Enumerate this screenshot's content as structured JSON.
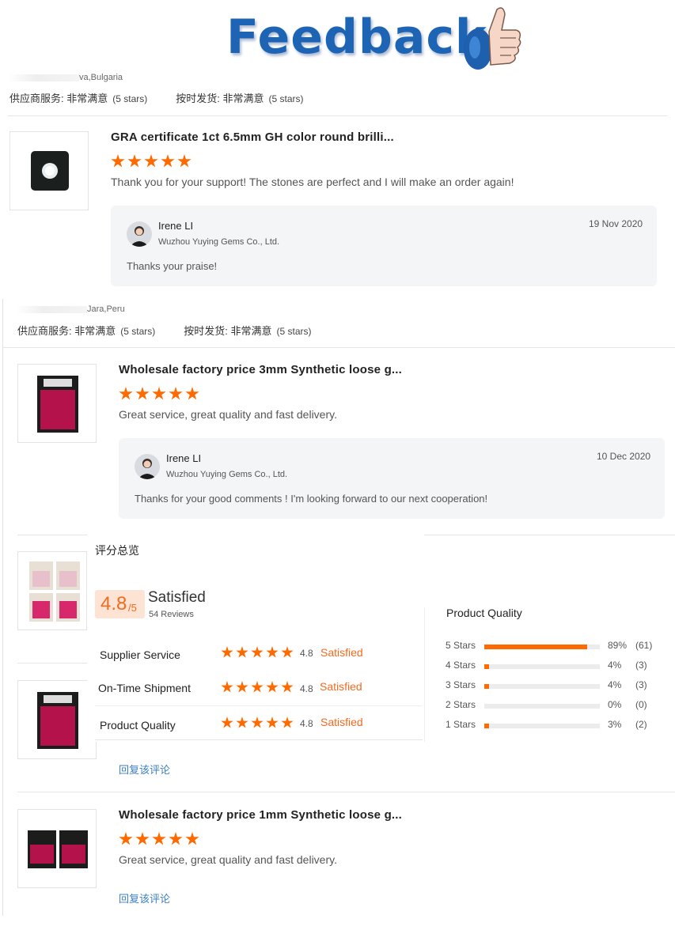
{
  "header": {
    "title": "Feedback",
    "logo_icon": "thumbs-up-icon"
  },
  "reviews": [
    {
      "location": "va,Bulgaria",
      "supplier_service_label": "供应商服务:",
      "supplier_service_value": "非常满意",
      "supplier_service_stars": "(5 stars)",
      "shipment_label": "按时发货:",
      "shipment_value": "非常满意",
      "shipment_stars": "(5 stars)",
      "product_title": "GRA certificate 1ct 6.5mm GH color round brilli...",
      "rating": 5,
      "text": "Thank you for your support! The stones are perfect and I will make an order again!",
      "reply": {
        "name": "Irene LI",
        "company": "Wuzhou Yuying Gems Co., Ltd.",
        "date": "19 Nov 2020",
        "message": "Thanks your praise!"
      }
    },
    {
      "location": "Jara,Peru",
      "supplier_service_label": "供应商服务:",
      "supplier_service_value": "非常满意",
      "supplier_service_stars": "(5 stars)",
      "shipment_label": "按时发货:",
      "shipment_value": "非常满意",
      "shipment_stars": "(5 stars)",
      "product_title": "Wholesale factory price 3mm Synthetic loose g...",
      "rating": 5,
      "text": "Great service, great quality and fast delivery.",
      "reply": {
        "name": "Irene LI",
        "company": "Wuzhou Yuying Gems Co., Ltd.",
        "date": "10 Dec 2020",
        "message": "Thanks for your good comments ! I'm looking forward to our next cooperation!"
      }
    },
    {
      "reply_link": "回复该评论"
    },
    {
      "product_title": "Wholesale factory price 1mm Synthetic loose g...",
      "rating": 5,
      "text": "Great service, great quality and fast delivery.",
      "reply_link": "回复该评论"
    }
  ],
  "overview": {
    "title": "评分总览",
    "score": "4.8",
    "score_max": "/5",
    "label": "Satisfied",
    "reviews_count": "54 Reviews",
    "categories": [
      {
        "name": "Supplier Service",
        "score": "4.8",
        "label": "Satisfied"
      },
      {
        "name": "On-Time Shipment",
        "score": "4.8",
        "label": "Satisfied"
      },
      {
        "name": "Product Quality",
        "score": "4.8",
        "label": "Satisfied"
      }
    ],
    "quality": {
      "title": "Product Quality",
      "rows": [
        {
          "label": "5 Stars",
          "percent": "89%",
          "count": "(61)",
          "fraction": 0.89
        },
        {
          "label": "4 Stars",
          "percent": "4%",
          "count": "(3)",
          "fraction": 0.04
        },
        {
          "label": "3 Stars",
          "percent": "4%",
          "count": "(3)",
          "fraction": 0.04
        },
        {
          "label": "2 Stars",
          "percent": "0%",
          "count": "(0)",
          "fraction": 0.0
        },
        {
          "label": "1 Stars",
          "percent": "3%",
          "count": "(2)",
          "fraction": 0.03
        }
      ]
    }
  },
  "colors": {
    "accent": "#ff6a00",
    "title_blue": "#1e64b4",
    "link": "#3b7fc4",
    "score_bg": "#fde3d4"
  }
}
